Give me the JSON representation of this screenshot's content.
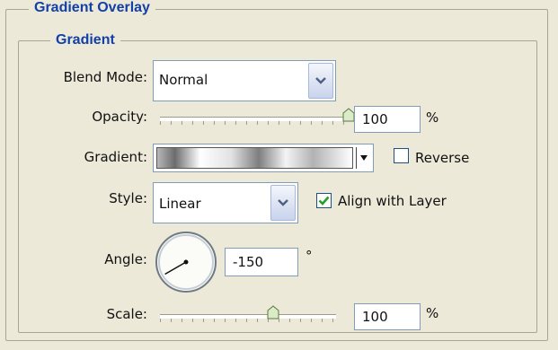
{
  "panel": {
    "title": "Gradient Overlay",
    "group_title": "Gradient"
  },
  "blend_mode": {
    "label": "Blend Mode:",
    "value": "Normal"
  },
  "opacity": {
    "label": "Opacity:",
    "value": "100",
    "unit": "%",
    "slider_level": 1.0
  },
  "gradient": {
    "label": "Gradient:",
    "reverse_label": "Reverse",
    "reverse_checked": false
  },
  "style": {
    "label": "Style:",
    "value": "Linear",
    "align_label": "Align with Layer",
    "align_checked": true
  },
  "angle": {
    "label": "Angle:",
    "value": "-150",
    "unit": "°",
    "degrees": -150
  },
  "scale": {
    "label": "Scale:",
    "value": "100",
    "unit": "%",
    "slider_level": 0.6
  },
  "colors": {
    "group_title": "#1240a8",
    "field_border": "#7f9db9",
    "check_mark": "#21a121",
    "thumb_fill": "#d9ebc8",
    "thumb_border": "#5a7a3a"
  },
  "icons": {
    "dropdown": "chevron-down-icon",
    "gradient_dropdown": "triangle-down-icon",
    "check": "check-mark-icon",
    "slider_thumb": "slider-thumb-icon"
  }
}
